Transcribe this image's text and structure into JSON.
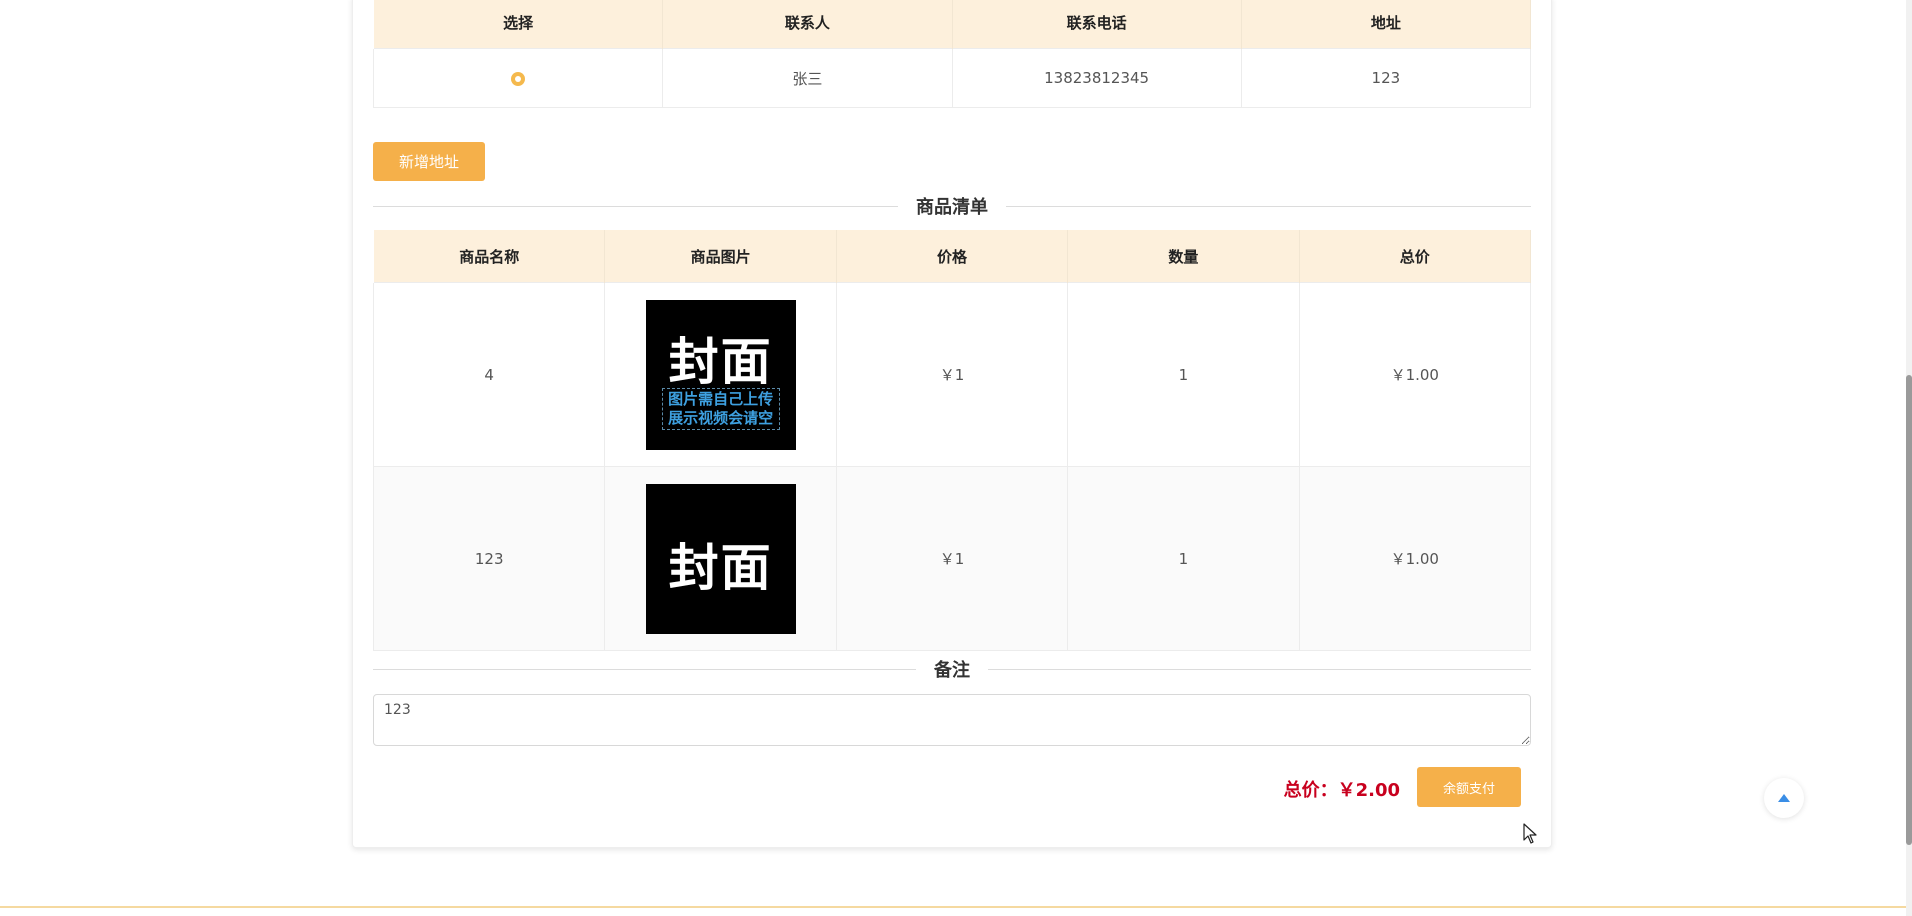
{
  "address": {
    "headers": [
      "选择",
      "联系人",
      "联系电话",
      "地址"
    ],
    "rows": [
      {
        "selected": true,
        "contact": "张三",
        "phone": "13823812345",
        "address": "123"
      }
    ],
    "add_button": "新增地址"
  },
  "goods": {
    "section_title": "商品清单",
    "headers": [
      "商品名称",
      "商品图片",
      "价格",
      "数量",
      "总价"
    ],
    "rows": [
      {
        "name": "4",
        "cover_title": "封面",
        "cover_lines": [
          "图片需自己上传",
          "展示视频会请空"
        ],
        "price": "￥1",
        "qty": "1",
        "total": "￥1.00"
      },
      {
        "name": "123",
        "cover_title": "封面",
        "cover_lines": [],
        "price": "￥1",
        "qty": "1",
        "total": "￥1.00"
      }
    ]
  },
  "remark": {
    "section_title": "备注",
    "value": "123"
  },
  "summary": {
    "total_label": "总价：￥2.00",
    "pay_button": "余额支付"
  },
  "colors": {
    "accent": "#f5b04a",
    "header_bg": "#fdf0dc",
    "total_red": "#c8001e",
    "cover_sub_blue": "#3ea0e0"
  },
  "icons": {
    "back_to_top": "caret-up-icon",
    "radio": "radio-selected-icon"
  }
}
